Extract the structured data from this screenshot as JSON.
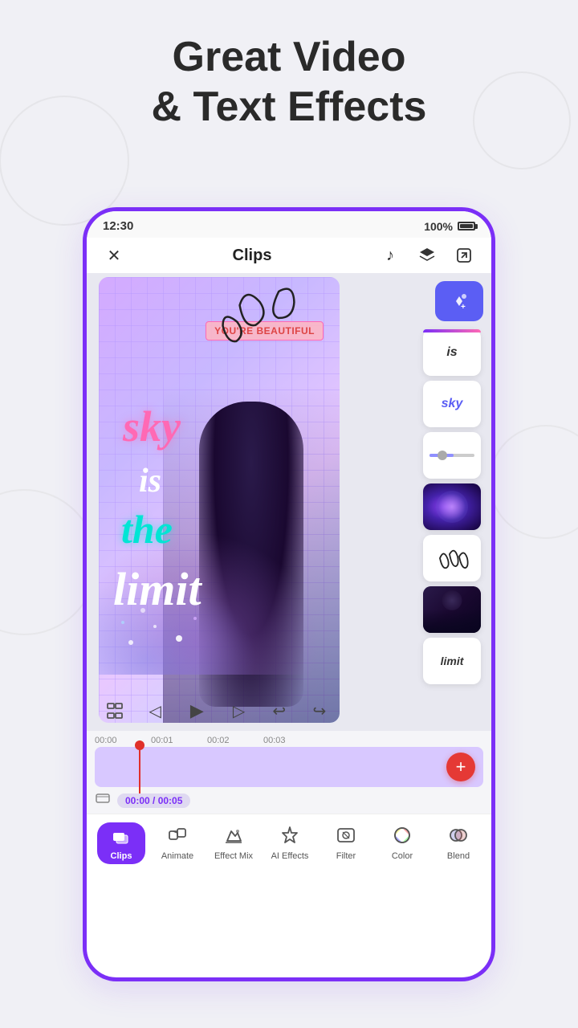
{
  "page": {
    "title_line1": "Great Video",
    "title_line2": "& Text Effects",
    "background_color": "#f0f0f5"
  },
  "status_bar": {
    "time": "12:30",
    "battery_percent": "100%"
  },
  "top_bar": {
    "title": "Clips",
    "close_icon": "✕",
    "music_icon": "♪",
    "layers_icon": "⧉",
    "export_icon": "⤴"
  },
  "canvas": {
    "texts": [
      "sky",
      "is",
      "the",
      "limit"
    ],
    "pink_label": "YOU'RE BEAUTIFUL",
    "ai_button_icon": "✦+"
  },
  "side_panel": {
    "cards": [
      {
        "type": "text",
        "value": "is"
      },
      {
        "type": "text",
        "value": "sky"
      },
      {
        "type": "bar",
        "value": ""
      },
      {
        "type": "galaxy"
      },
      {
        "type": "doodle"
      },
      {
        "type": "dark"
      },
      {
        "type": "text",
        "value": "limit"
      }
    ]
  },
  "controls": {
    "prev_icon": "◁",
    "play_icon": "▶",
    "next_icon": "▷",
    "undo_icon": "↩",
    "redo_icon": "↪",
    "fullscreen_icon": "⛶"
  },
  "timeline": {
    "ruler_labels": [
      "00:00",
      "00:01",
      "00:02",
      "00:03"
    ],
    "time_display": "00:00 / 00:05",
    "add_icon": "+"
  },
  "toolbar": {
    "items": [
      {
        "id": "animate",
        "label": "Animate",
        "icon": "animate",
        "active": false
      },
      {
        "id": "effect-mix",
        "label": "Effect Mix",
        "icon": "effect-mix",
        "active": false
      },
      {
        "id": "ai-effects",
        "label": "AI Effects",
        "icon": "ai-effects",
        "active": false
      },
      {
        "id": "filter",
        "label": "Filter",
        "icon": "filter",
        "active": false
      },
      {
        "id": "color",
        "label": "Color",
        "icon": "color",
        "active": false
      },
      {
        "id": "blend",
        "label": "Blend",
        "icon": "blend",
        "active": false
      }
    ],
    "active_item": "clips",
    "clips_label": "Clips"
  }
}
